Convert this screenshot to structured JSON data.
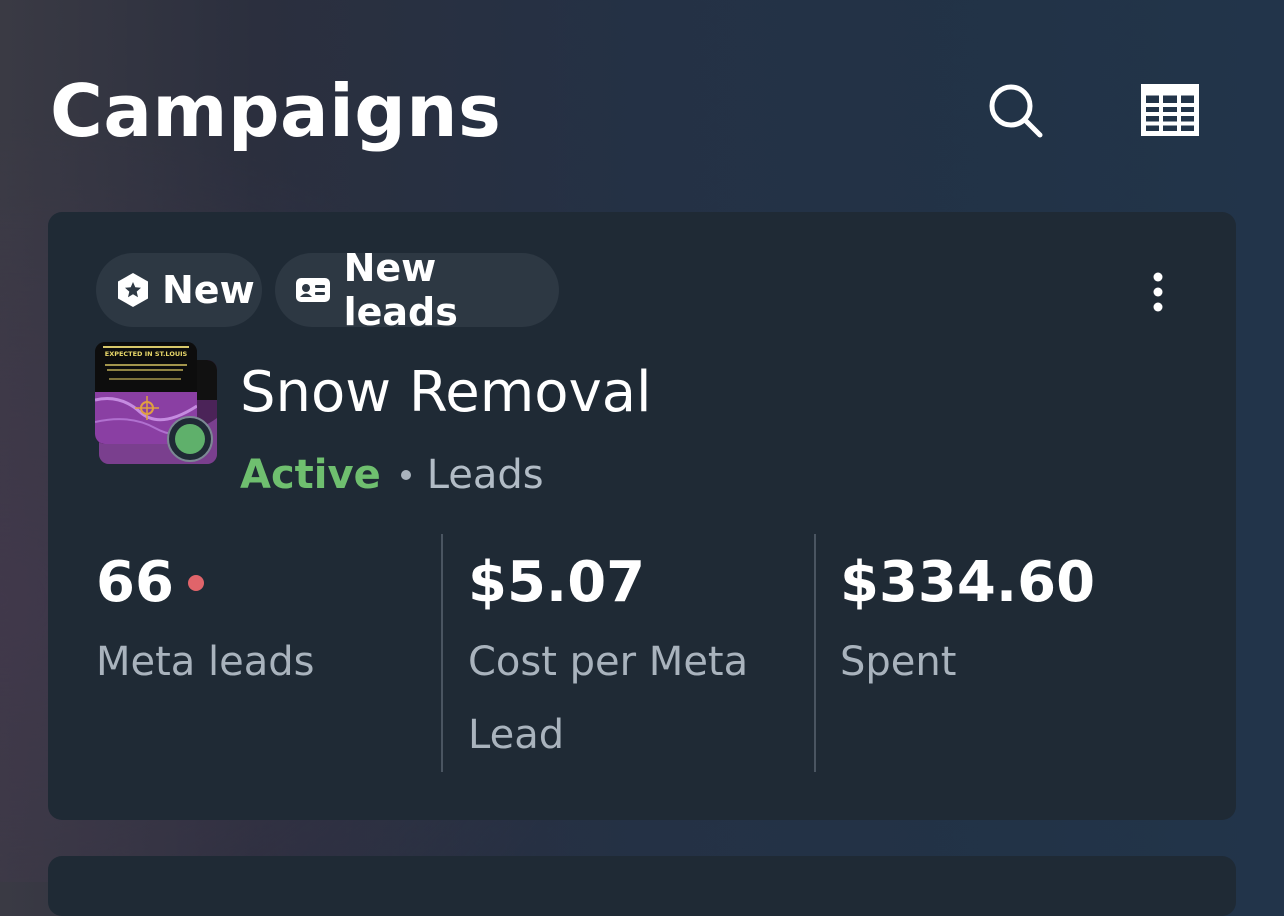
{
  "header": {
    "title": "Campaigns",
    "icons": {
      "search": "search-icon",
      "table": "table-view-icon"
    }
  },
  "campaign": {
    "badges": [
      {
        "label": "New",
        "icon": "new-badge-icon"
      },
      {
        "label": "New leads",
        "icon": "lead-card-icon"
      }
    ],
    "name": "Snow Removal",
    "status": "Active",
    "type": "Leads",
    "thumbnail_text": "EXPECTED IN ST.LOUIS",
    "stats": [
      {
        "value": "66",
        "label": "Meta leads",
        "has_alert": true
      },
      {
        "value": "$5.07",
        "label": "Cost per Meta Lead"
      },
      {
        "value": "$334.60",
        "label": "Spent"
      }
    ]
  },
  "colors": {
    "card": "#1f2a35",
    "chip": "#2d3843",
    "active": "#6fbf6f",
    "alert": "#e0646a",
    "muted": "#a9b3bd"
  }
}
